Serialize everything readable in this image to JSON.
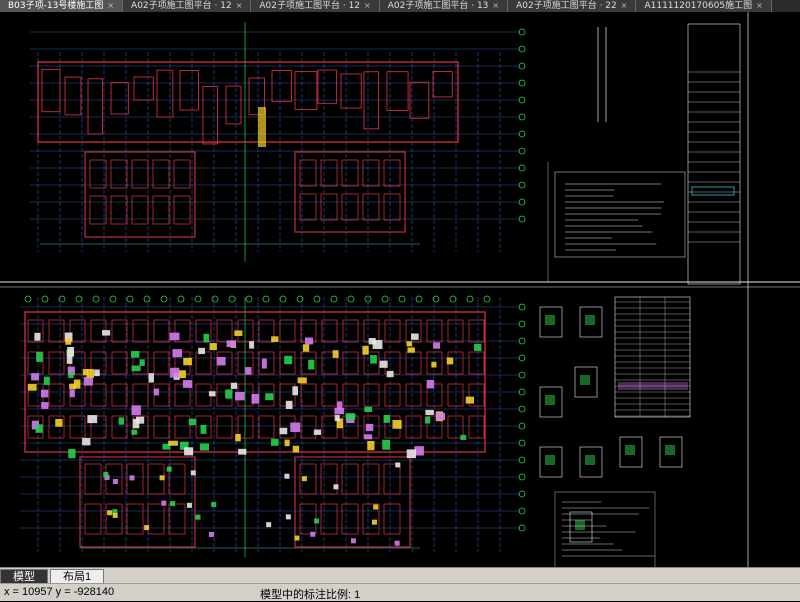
{
  "tabs": [
    {
      "label": "B03子项-13号楼施工图",
      "active": true
    },
    {
      "label": "A02子项施工图平台 · 12",
      "active": false
    },
    {
      "label": "A02子项施工图平台 · 12",
      "active": false
    },
    {
      "label": "A02子项施工图平台 · 13",
      "active": false
    },
    {
      "label": "A02子项施工图平台 · 22",
      "active": false
    },
    {
      "label": "A1111120170605施工图",
      "active": false
    }
  ],
  "tab_close_glyph": "×",
  "layout_tabs": [
    {
      "label": "模型",
      "active": true
    },
    {
      "label": "布局1",
      "active": false
    }
  ],
  "status": {
    "coords": "x = 10957   y = -928140",
    "annotation_scale": "模型中的标注比例: 1"
  },
  "colors": {
    "background": "#000000",
    "wall_red": "#e8334a",
    "grid_blue": "#3a6cd8",
    "annot_green": "#25d24a",
    "yellow": "#f2d12a",
    "magenta": "#d37cf0",
    "white": "#e8e8e8",
    "dim_cyan": "#2ec6c6"
  }
}
